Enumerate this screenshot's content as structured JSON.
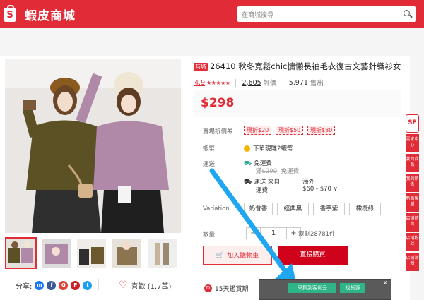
{
  "header": {
    "logo_text": "蝦皮商城",
    "search_placeholder": "在商城搜尋"
  },
  "product": {
    "mall_badge": "商城",
    "title": "26410 秋冬寬鬆chic慵懶長袖毛衣復古文藝針織衫女",
    "rating": "4.9",
    "stars": "★★★★★",
    "reviews_count": "2,605",
    "reviews_label": "評價",
    "sold_count": "5,971",
    "sold_label": "售出",
    "price": "$298"
  },
  "vouchers": {
    "label": "賣場折價券",
    "items": [
      "現折$20",
      "現折$50",
      "現折$80"
    ]
  },
  "coins": {
    "label": "蝦幣",
    "text": "下單現賺2蝦幣"
  },
  "shipping": {
    "label": "運送",
    "free_label": "免運費",
    "free_sub_strike": "$299",
    "free_sub_suffix": "免運費",
    "from_label": "運送 來自",
    "fee_label": "運費",
    "from_value": "海外",
    "fee_range": "$60 - $70 ∨"
  },
  "variation": {
    "label": "Variation",
    "options": [
      "奶昔香",
      "經典黑",
      "香芋紫",
      "橄欖綠"
    ]
  },
  "quantity": {
    "label": "數量",
    "minus": "−",
    "value": "1",
    "plus": "+",
    "stock": "還剩28781件"
  },
  "actions": {
    "add_to_cart": "加入購物車",
    "buy_now": "直接購買"
  },
  "share": {
    "label": "分享:",
    "icons": [
      "messenger-icon",
      "facebook-icon",
      "googleplus-icon",
      "pinterest-icon",
      "twitter-icon"
    ]
  },
  "like": {
    "label": "喜歡 (1.7萬)"
  },
  "guarantee": {
    "label": "15天鑑賞期"
  },
  "side_rail": {
    "logo": "SF",
    "items": [
      "賣家中心",
      "我的商品",
      "我的銷售",
      "新版聯盟",
      "店铺前台",
      "店铺粉丝",
      "店铺清粉"
    ]
  },
  "plugin_popup": {
    "primary": "采集到客优云",
    "secondary": "找货源",
    "close": "x"
  },
  "colors": {
    "brand": "#e12b36",
    "price": "#e12b36",
    "plugin_green": "#2fb487"
  }
}
